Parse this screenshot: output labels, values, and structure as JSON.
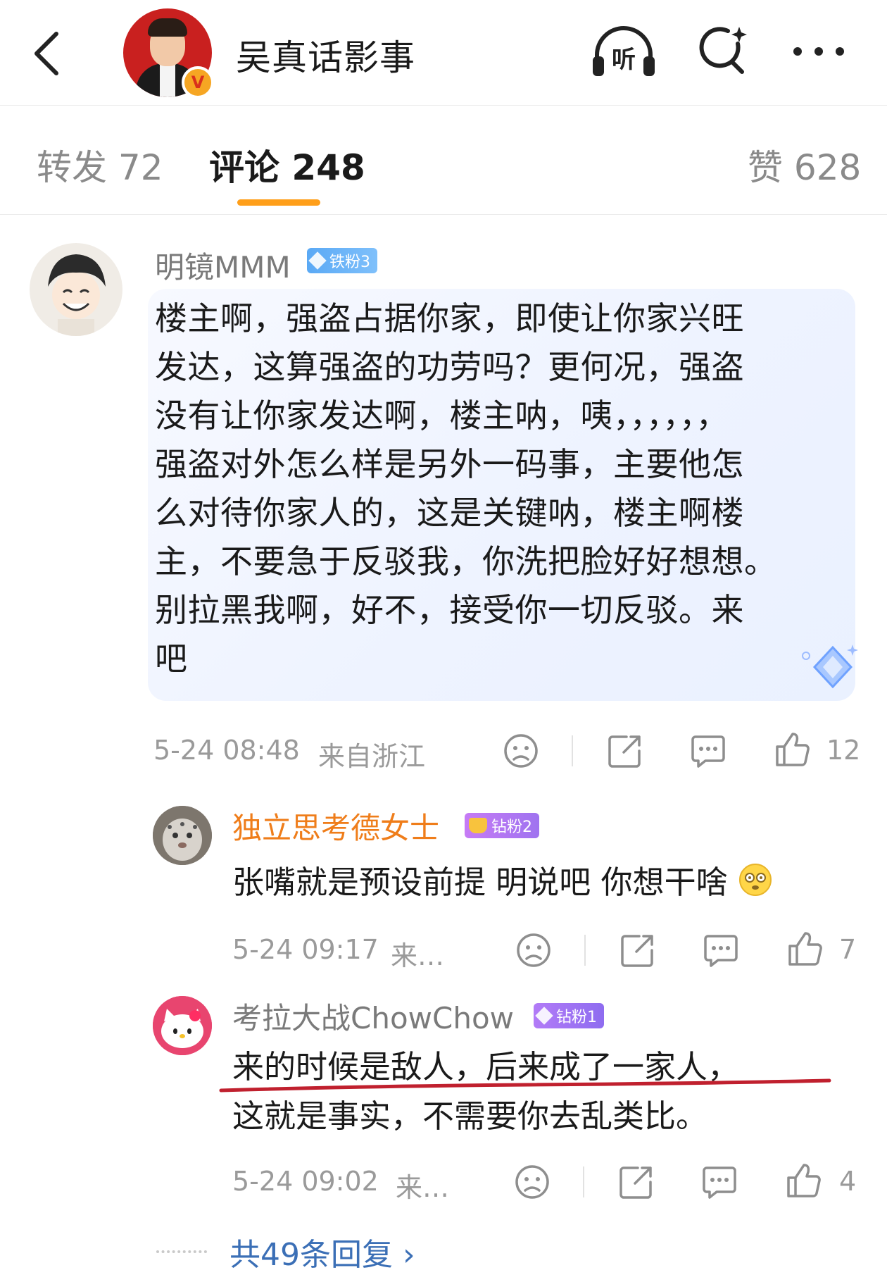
{
  "header": {
    "back_icon": "chevron-left-icon",
    "title": "吴真话影事",
    "verified_badge": "V",
    "listen_label": "听",
    "colors": {
      "avatar_bg": "#c9201f",
      "verified": "#f6a623"
    }
  },
  "tabs": [
    {
      "label": "转发",
      "count": "72"
    },
    {
      "label": "评论",
      "count": "248",
      "active": true
    },
    {
      "label": "赞",
      "count": "628"
    }
  ],
  "tab_text": {
    "repost": "转发 72",
    "comment": "评论 248",
    "like": "赞 628"
  },
  "accent_color": "#ff9f1a",
  "main_comment": {
    "username": "明镜MMM",
    "badge": "铁粉3",
    "lines": [
      "楼主啊，强盗占据你家，即使让你家兴旺",
      "发达，这算强盗的功劳吗？更何况，强盗",
      "没有让你家发达啊，楼主呐，咦，，，，，，",
      "强盗对外怎么样是另外一码事，主要他怎",
      "么对待你家人的，这是关键呐，楼主啊楼",
      "主，不要急于反驳我，你洗把脸好好想想。",
      "别拉黑我啊，好不，接受你一切反驳。来",
      "吧"
    ],
    "time": "5-24 08:48",
    "location": "来自浙江",
    "likes": "12"
  },
  "replies": [
    {
      "username": "独立思考德女士",
      "badge": "钻粉2",
      "text": "张嘴就是预设前提 明说吧 你想干啥",
      "emoji": "dizzy-emoji-icon",
      "time": "5-24 09:17",
      "location": "来…",
      "likes": "7"
    },
    {
      "username": "考拉大战ChowChow",
      "badge": "钻粉1",
      "line1": "来的时候是敌人，后来成了一家人，",
      "line2": "这就是事实，不需要你去乱类比。",
      "time": "5-24 09:02",
      "location": "来…",
      "likes": "4"
    }
  ],
  "more_replies": "共49条回复 ›"
}
